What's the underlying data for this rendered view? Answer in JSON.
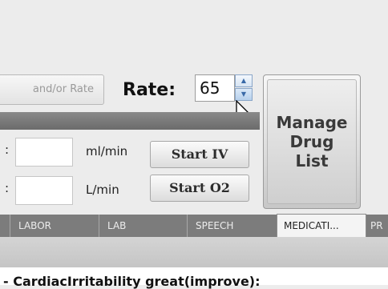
{
  "rate_row": {
    "clipped_button_label": "and/or Rate",
    "rate_label": "Rate:",
    "rate_value": "65",
    "spinner_up_glyph": "▲",
    "spinner_down_glyph": "▼"
  },
  "manage_button": {
    "label": "Manage\nDrug\nList"
  },
  "iv_row": {
    "colon": ":",
    "value": "",
    "unit": "ml/min",
    "button_label": "Start IV"
  },
  "o2_row": {
    "colon": ":",
    "value": "",
    "unit": "L/min",
    "button_label": "Start O2"
  },
  "tabs": [
    {
      "label": "LABOR"
    },
    {
      "label": "LAB"
    },
    {
      "label": "SPEECH"
    },
    {
      "label": "MEDICATI..."
    },
    {
      "label": "PR"
    }
  ],
  "content": {
    "text": "- CardiacIrritability great(improve):"
  },
  "icons": {
    "cursor": "arrow-cursor-icon"
  },
  "colors": {
    "tab_strip": "#7c7c7c",
    "section_bar": "#757575",
    "active_tab": "#f4f4f4"
  }
}
